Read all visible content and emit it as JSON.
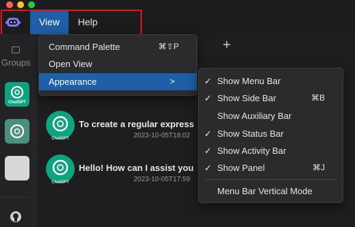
{
  "menubar": {
    "items": [
      "View",
      "Help"
    ]
  },
  "sidebar": {
    "groups_label": "Groups",
    "tile_label": "ChatGPT"
  },
  "view_menu": {
    "items": [
      {
        "label": "Command Palette",
        "shortcut": "⌘⇧P"
      },
      {
        "label": "Open View",
        "shortcut": ""
      },
      {
        "label": "Appearance",
        "submenu": true
      }
    ]
  },
  "appearance_menu": {
    "items": [
      {
        "label": "Show Menu Bar",
        "checked": true,
        "shortcut": ""
      },
      {
        "label": "Show Side Bar",
        "checked": true,
        "shortcut": "⌘B"
      },
      {
        "label": "Show Auxiliary Bar",
        "checked": false,
        "shortcut": ""
      },
      {
        "label": "Show Status Bar",
        "checked": true,
        "shortcut": ""
      },
      {
        "label": "Show Activity Bar",
        "checked": true,
        "shortcut": ""
      },
      {
        "label": "Show Panel",
        "checked": true,
        "shortcut": "⌘J"
      },
      {
        "label": "Menu Bar Vertical Mode",
        "checked": false,
        "shortcut": ""
      }
    ],
    "check_glyph": "✓"
  },
  "chats": [
    {
      "title": "To create a regular express",
      "time": "2023-10-05T18:02",
      "avatar_label": "ChatGPT"
    },
    {
      "title": "Hello! How can I assist you",
      "time": "2023-10-05T17:59",
      "avatar_label": "ChatGPT"
    }
  ],
  "main": {
    "add_glyph": "+"
  },
  "colors": {
    "accent": "#1f5fa8",
    "highlight_box": "#e0191f",
    "chatgpt_green": "#10a37f"
  }
}
